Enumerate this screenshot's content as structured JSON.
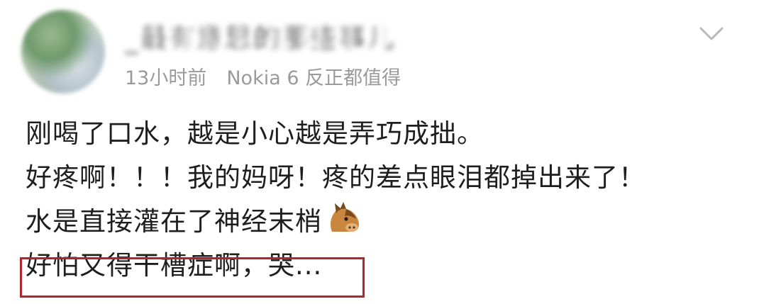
{
  "post": {
    "username": "_最有意思的那些事儿",
    "time": "13小时前",
    "device": "Nokia 6 反正都值得",
    "lines": [
      "刚喝了口水，越是小心越是弄巧成拙。",
      "好疼啊！！！我的妈呀！疼的差点眼泪都掉出来了！",
      "水是直接灌在了神经末梢",
      "好怕又得干槽症啊，哭..."
    ],
    "emoji_icon": "horse-face-icon",
    "menu_icon": "chevron-down-icon",
    "highlight_color": "#b4232f",
    "meta_color": "#9a9a9a"
  }
}
